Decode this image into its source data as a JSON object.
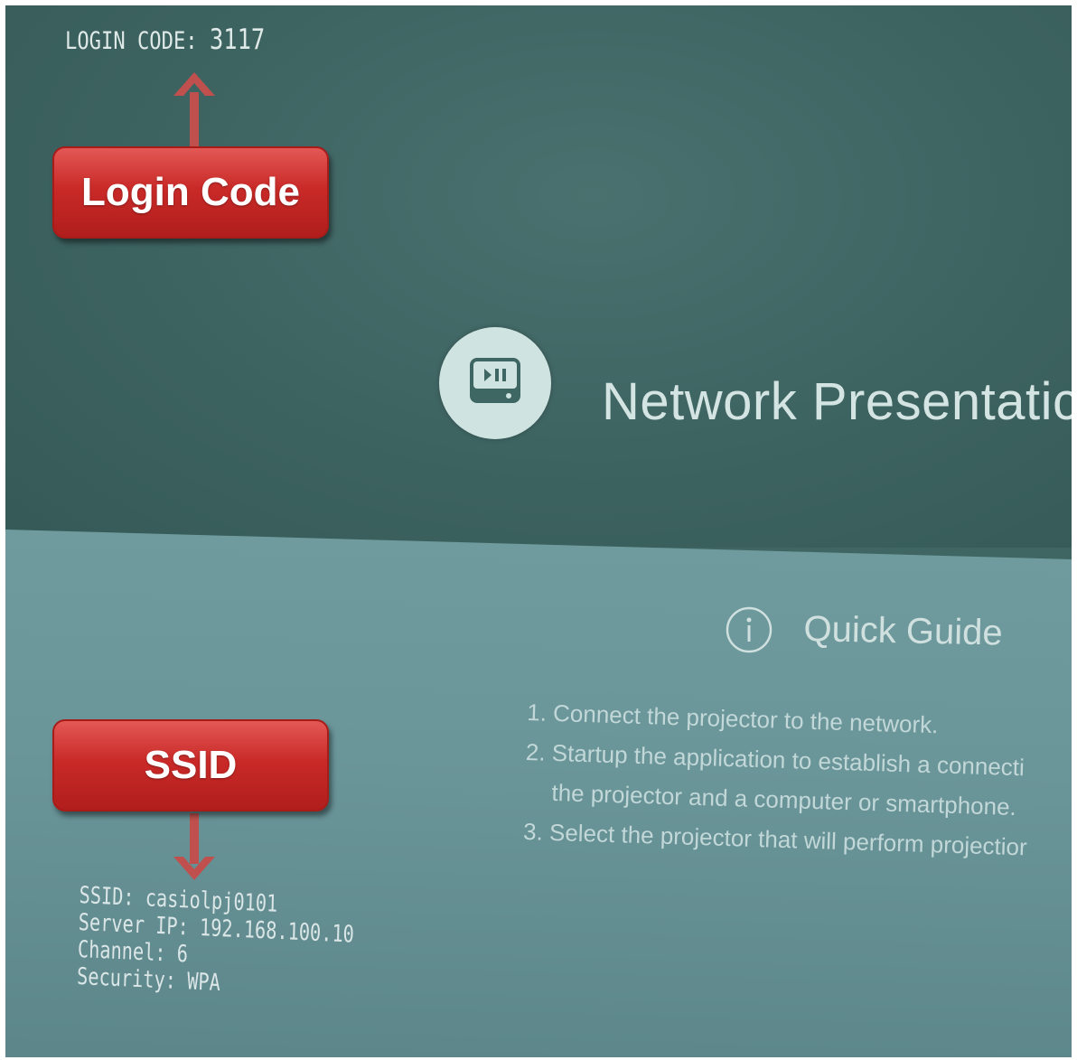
{
  "login": {
    "label": "LOGIN CODE:",
    "value": "3117"
  },
  "app": {
    "title": "Network Presentatic",
    "icon": "play-pause-icon"
  },
  "quick_guide": {
    "title": "Quick Guide",
    "icon": "info-icon",
    "steps": [
      "1. Connect the projector to the network.",
      "2. Startup the application to establish a connecti",
      "the projector and a computer or smartphone.",
      "3. Select the projector that will perform projectior"
    ]
  },
  "network": {
    "ssid": "SSID: casiolpj0101",
    "server_ip": "Server IP: 192.168.100.10",
    "channel": "Channel: 6",
    "security": "Security: WPA"
  },
  "callouts": {
    "login_code": "Login Code",
    "ssid": "SSID"
  },
  "colors": {
    "screen_top": "#3f6663",
    "screen_bottom": "#6a9599",
    "callout_red": "#c92a28",
    "arrow_red": "#c0504d"
  }
}
